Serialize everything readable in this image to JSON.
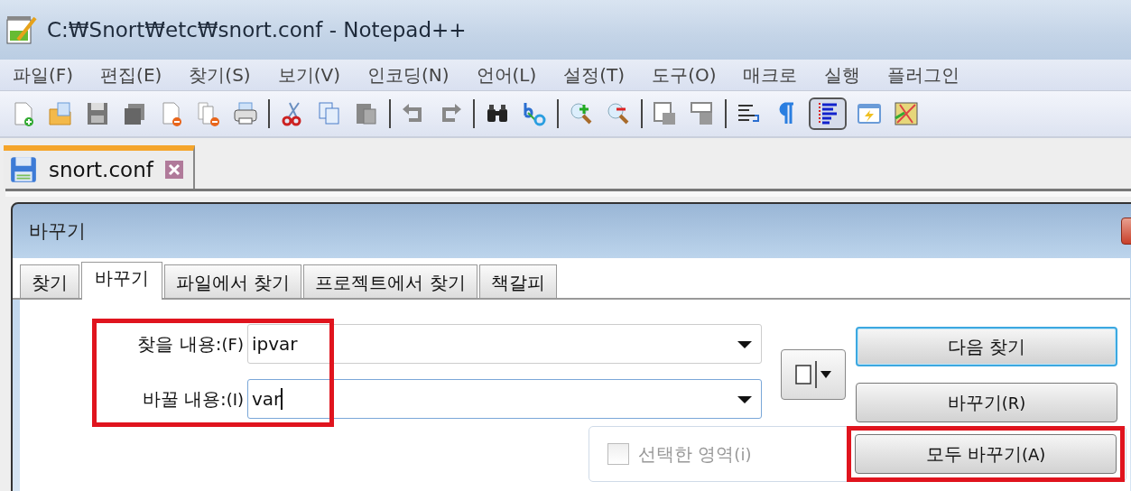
{
  "window": {
    "title": "C:₩Snort₩etc₩snort.conf - Notepad++"
  },
  "menu": [
    "파일(F)",
    "편집(E)",
    "찾기(S)",
    "보기(V)",
    "인코딩(N)",
    "언어(L)",
    "설정(T)",
    "도구(O)",
    "매크로",
    "실행",
    "플러그인"
  ],
  "toolbar": [
    {
      "kind": "button",
      "pressed": false
    },
    {
      "kind": "button",
      "pressed": false
    },
    {
      "kind": "button",
      "pressed": false
    },
    {
      "kind": "button",
      "pressed": false
    },
    {
      "kind": "button",
      "pressed": false
    },
    {
      "kind": "button",
      "pressed": false
    },
    {
      "kind": "button",
      "pressed": false
    },
    {
      "kind": "separator"
    },
    {
      "kind": "button",
      "pressed": false
    },
    {
      "kind": "button",
      "pressed": false
    },
    {
      "kind": "button",
      "pressed": false
    },
    {
      "kind": "separator"
    },
    {
      "kind": "button",
      "pressed": false
    },
    {
      "kind": "button",
      "pressed": false
    },
    {
      "kind": "separator"
    },
    {
      "kind": "button",
      "pressed": false
    },
    {
      "kind": "button",
      "pressed": false
    },
    {
      "kind": "separator"
    },
    {
      "kind": "button",
      "pressed": false
    },
    {
      "kind": "button",
      "pressed": false
    },
    {
      "kind": "separator"
    },
    {
      "kind": "button",
      "pressed": false
    },
    {
      "kind": "button",
      "pressed": false
    },
    {
      "kind": "separator"
    },
    {
      "kind": "button",
      "pressed": false
    },
    {
      "kind": "button",
      "pressed": false
    },
    {
      "kind": "button",
      "pressed": true
    },
    {
      "kind": "button",
      "pressed": false
    },
    {
      "kind": "button",
      "pressed": false
    }
  ],
  "doc_tabs": [
    {
      "label": "snort.conf",
      "selected": true
    }
  ],
  "dialog": {
    "title": "바꾸기",
    "tabs": [
      {
        "label": "찾기",
        "selected": false
      },
      {
        "label": "바꾸기",
        "selected": true
      },
      {
        "label": "파일에서 찾기",
        "selected": false
      },
      {
        "label": "프로젝트에서 찾기",
        "selected": false
      },
      {
        "label": "책갈피",
        "selected": false
      }
    ],
    "fields": {
      "highlighted": true,
      "rows": [
        {
          "label": "찾을 내용:",
          "hotkey": "(F)",
          "value": "ipvar",
          "focused": false
        },
        {
          "label": "바꿀 내용:",
          "hotkey": "(I)",
          "value": "var",
          "focused": true
        }
      ]
    },
    "buttons": [
      {
        "label": "다음 찾기",
        "default": true
      },
      {
        "label": "바꾸기",
        "hotkey": "(R)",
        "default": false
      }
    ],
    "in_selection": {
      "label": "선택한 영역",
      "hotkey": "(i)",
      "checked": false,
      "disabled": true
    },
    "replace_all": {
      "label": "모두 바꾸기",
      "hotkey": "(A)",
      "highlighted": true
    }
  }
}
